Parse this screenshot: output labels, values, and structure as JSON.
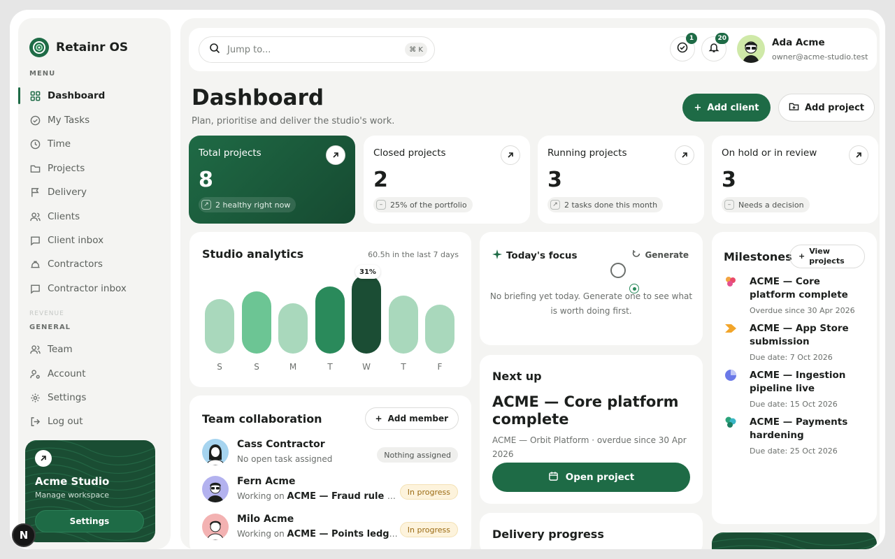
{
  "app": {
    "name": "Retainr OS"
  },
  "sidebar": {
    "menu_label": "MENU",
    "menu_items": [
      {
        "label": "Dashboard",
        "icon": "grid-icon",
        "active": true
      },
      {
        "label": "My Tasks",
        "icon": "check-circle-icon"
      },
      {
        "label": "Time",
        "icon": "clock-icon"
      },
      {
        "label": "Projects",
        "icon": "folder-icon"
      },
      {
        "label": "Delivery",
        "icon": "flag-icon"
      },
      {
        "label": "Clients",
        "icon": "users-icon"
      },
      {
        "label": "Client inbox",
        "icon": "message-icon"
      },
      {
        "label": "Contractors",
        "icon": "hard-hat-icon"
      },
      {
        "label": "Contractor inbox",
        "icon": "message-icon"
      }
    ],
    "faded_label": "REVENUE",
    "general_label": "GENERAL",
    "general_items": [
      {
        "label": "Team",
        "icon": "users-icon"
      },
      {
        "label": "Account",
        "icon": "user-cog-icon"
      },
      {
        "label": "Settings",
        "icon": "gear-icon"
      },
      {
        "label": "Log out",
        "icon": "logout-icon"
      }
    ],
    "promo": {
      "title": "Acme Studio",
      "subtitle": "Manage workspace",
      "button": "Settings"
    }
  },
  "topbar": {
    "search_placeholder": "Jump to...",
    "shortcut": "⌘ K",
    "tasks_count": "1",
    "notifications_count": "20",
    "user_name": "Ada Acme",
    "user_email": "owner@acme-studio.test"
  },
  "header": {
    "title": "Dashboard",
    "subtitle": "Plan, prioritise and deliver the studio's work.",
    "add_client": "Add client",
    "add_project": "Add project"
  },
  "stats": [
    {
      "label": "Total projects",
      "value": "8",
      "note": "2 healthy right now"
    },
    {
      "label": "Closed projects",
      "value": "2",
      "note": "25% of the portfolio"
    },
    {
      "label": "Running projects",
      "value": "3",
      "note": "2 tasks done this month"
    },
    {
      "label": "On hold or in review",
      "value": "3",
      "note": "Needs a decision"
    }
  ],
  "analytics": {
    "title": "Studio analytics",
    "summary": "60.5h in the last 7 days",
    "highlight": "31%",
    "chart_data": {
      "type": "bar",
      "categories": [
        "S",
        "S",
        "M",
        "T",
        "W",
        "T",
        "F"
      ],
      "values": [
        78,
        89,
        72,
        96,
        113,
        83,
        70
      ],
      "colors": [
        "#a9d8bc",
        "#6cc594",
        "#a9d8bc",
        "#2a8a5b",
        "#1b4d34",
        "#a9d8bc",
        "#a9d8bc"
      ]
    }
  },
  "focus": {
    "title": "Today's focus",
    "generate": "Generate",
    "empty": "No briefing yet today. Generate one to see what is worth doing first."
  },
  "next_up": {
    "title": "Next up",
    "project": "ACME — Core platform complete",
    "meta": "ACME — Orbit Platform · overdue since 30 Apr 2026",
    "button": "Open project"
  },
  "delivery": {
    "title": "Delivery progress"
  },
  "team": {
    "title": "Team collaboration",
    "add_member": "Add member",
    "working_on": "Working on",
    "members": [
      {
        "name": "Cass Contractor",
        "sub": "No open task assigned",
        "task": "",
        "status": "Nothing assigned"
      },
      {
        "name": "Fern Acme",
        "sub": "",
        "task": "ACME — Fraud rule tuning",
        "status": "In progress"
      },
      {
        "name": "Milo Acme",
        "sub": "",
        "task": "ACME — Points ledger reconciliation",
        "status": "In progress"
      }
    ]
  },
  "milestones": {
    "title": "Milestones",
    "view_projects": "View projects",
    "items": [
      {
        "title": "ACME — Core platform complete",
        "date": "Overdue since 30 Apr 2026"
      },
      {
        "title": "ACME — App Store submission",
        "date": "Due date: 7 Oct 2026"
      },
      {
        "title": "ACME — Ingestion pipeline live",
        "date": "Due date: 15 Oct 2026"
      },
      {
        "title": "ACME — Payments hardening",
        "date": "Due date: 25 Oct 2026"
      }
    ]
  }
}
